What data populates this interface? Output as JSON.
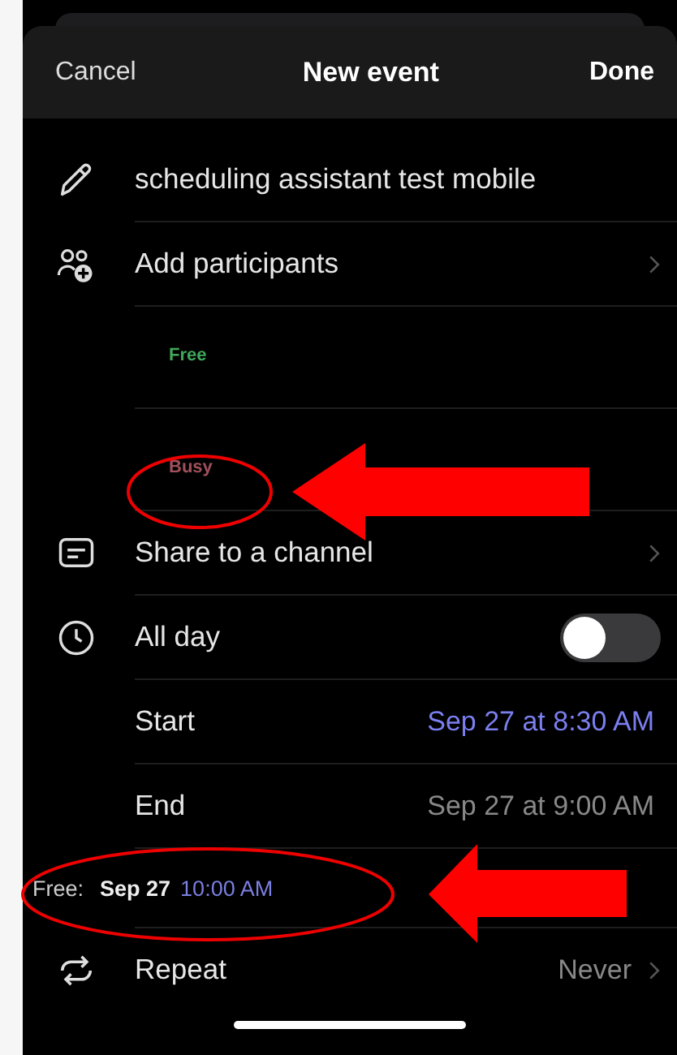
{
  "sheet": {
    "cancel": "Cancel",
    "title": "New event",
    "done": "Done"
  },
  "title_field": {
    "value": "scheduling assistant test mobile"
  },
  "participants": {
    "label": "Add participants"
  },
  "availability": [
    {
      "status": "Free",
      "kind": "free"
    },
    {
      "status": "Busy",
      "kind": "busy"
    }
  ],
  "share": {
    "label": "Share to a channel"
  },
  "all_day": {
    "label": "All day",
    "on": false
  },
  "times": [
    {
      "label": "Start",
      "value": "Sep 27 at 8:30 AM",
      "selected": true
    },
    {
      "label": "End",
      "value": "Sep 27 at 9:00 AM",
      "selected": false
    }
  ],
  "suggestion": {
    "label": "Free:",
    "date": "Sep 27",
    "time": "10:00 AM"
  },
  "repeat": {
    "label": "Repeat",
    "value": "Never"
  }
}
